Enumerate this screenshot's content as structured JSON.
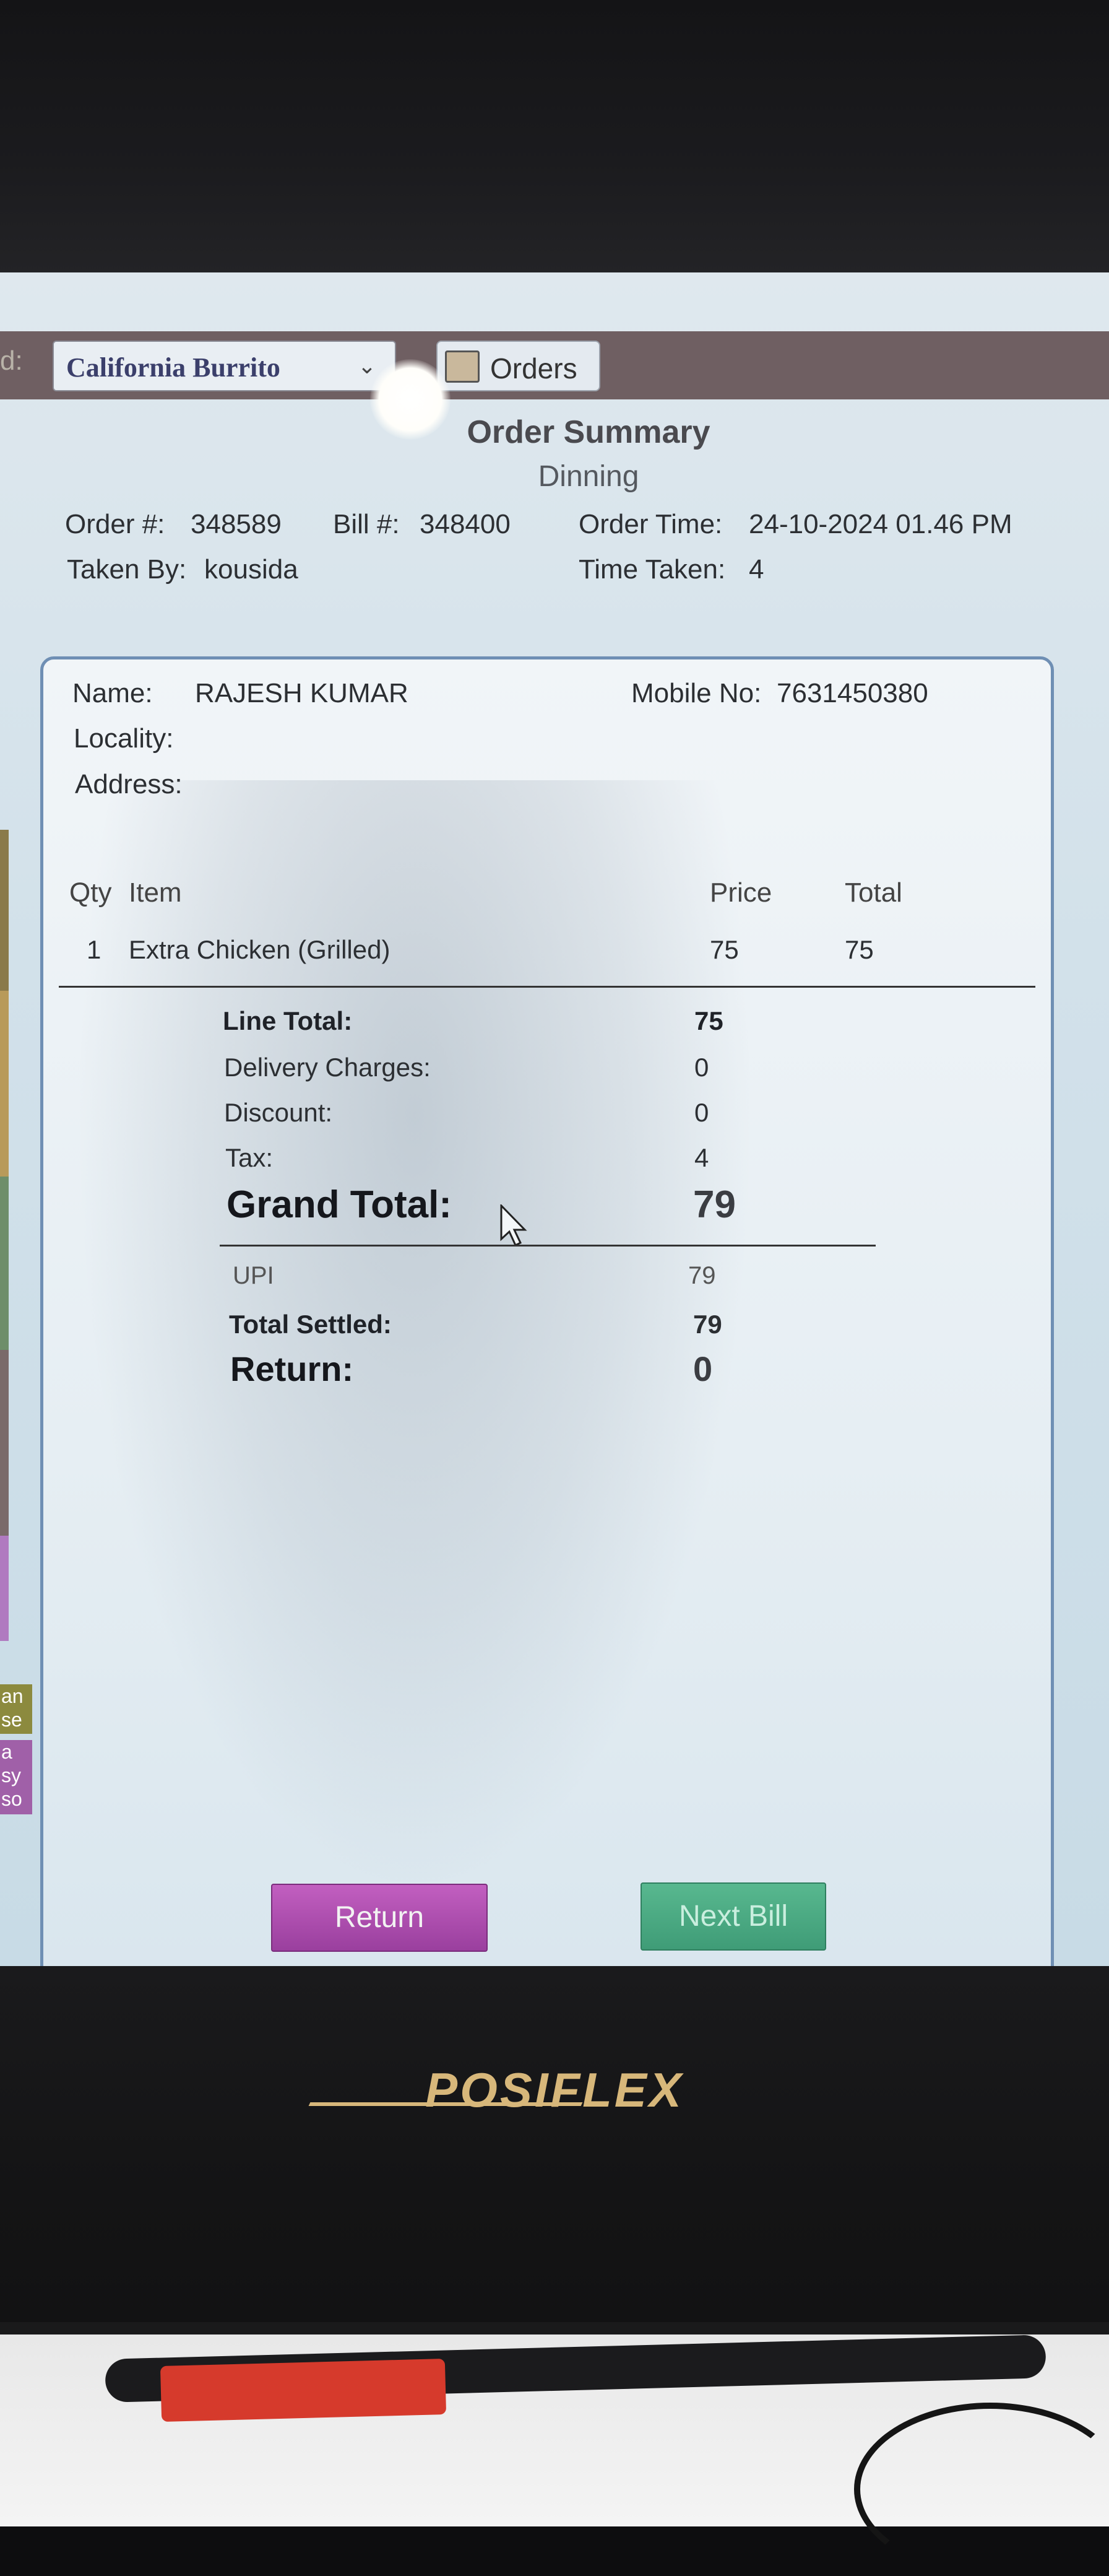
{
  "toolbar": {
    "left_fragment": "d:",
    "store_value": "California Burrito",
    "orders_label": "Orders"
  },
  "header": {
    "title": "Order Summary",
    "subtitle": "Dinning",
    "order_no_label": "Order #:",
    "order_no": "348589",
    "bill_no_label": "Bill #:",
    "bill_no": "348400",
    "order_time_label": "Order Time:",
    "order_time": "24-10-2024 01.46 PM",
    "taken_by_label": "Taken By:",
    "taken_by": "kousida",
    "time_taken_label": "Time Taken:",
    "time_taken": "4"
  },
  "customer": {
    "name_label": "Name:",
    "name": "RAJESH KUMAR",
    "mobile_label": "Mobile No:",
    "mobile": "7631450380",
    "locality_label": "Locality:",
    "address_label": "Address:"
  },
  "items": {
    "headers": {
      "qty": "Qty",
      "item": "Item",
      "price": "Price",
      "total": "Total"
    },
    "rows": [
      {
        "qty": "1",
        "item": "Extra Chicken (Grilled)",
        "price": "75",
        "total": "75"
      }
    ]
  },
  "totals": {
    "line_total_label": "Line Total:",
    "line_total": "75",
    "delivery_label": "Delivery Charges:",
    "delivery": "0",
    "discount_label": "Discount:",
    "discount": "0",
    "tax_label": "Tax:",
    "tax": "4",
    "grand_total_label": "Grand Total:",
    "grand_total": "79",
    "payment_method": "UPI",
    "payment_amount": "79",
    "total_settled_label": "Total Settled:",
    "total_settled": "79",
    "return_label": "Return:",
    "return_amount": "0"
  },
  "side_tags": [
    "an",
    "se",
    "a",
    "sy",
    "so"
  ],
  "buttons": {
    "return": "Return",
    "next_bill": "Next Bill"
  },
  "device": {
    "brand": "POSIFLEX"
  }
}
